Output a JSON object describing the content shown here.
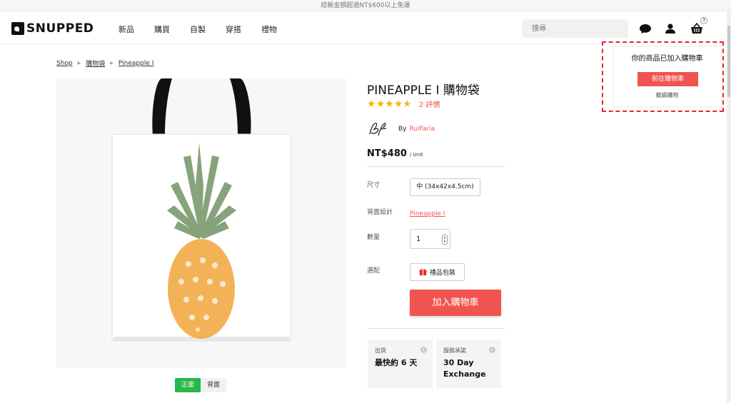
{
  "topbar": {
    "text": "結帳金額超過NT$600以上免運"
  },
  "header": {
    "logo": "SNUPPED",
    "nav": [
      "新品",
      "購買",
      "自製",
      "穿搭",
      "禮物"
    ],
    "search_placeholder": "搜尋",
    "cart_count": "3"
  },
  "breadcrumb": [
    "Shop",
    "購物袋",
    "Pineapple I"
  ],
  "product": {
    "title": "PINEAPPLE I 購物袋",
    "rating_stars": 4.5,
    "reviews": "2 評價",
    "by": "By",
    "artist": "RuiFaria",
    "price": "NT$480",
    "unit": "/ Unit"
  },
  "options": {
    "size_label": "尺寸",
    "size_value": "中 (34x42x4.5cm)",
    "back_label": "背面設計",
    "back_value": "Pineapple I",
    "qty_label": "數量",
    "qty_value": "1",
    "extra_label": "選配",
    "gift_label": "禮品包裝",
    "add_to_cart": "加入購物車"
  },
  "side_toggle": {
    "front": "正面",
    "back": "背面"
  },
  "info": [
    {
      "label": "出貨",
      "value": "最快約 6 天"
    },
    {
      "label": "服務承諾",
      "value": "30 Day Exchange"
    }
  ],
  "popup": {
    "title": "你的商品已加入購物車",
    "button": "前往購物車",
    "link": "繼續購物"
  },
  "colors": {
    "accent": "#f0544f",
    "active_toggle": "#27b849",
    "highlight": "#e8262c",
    "star": "#f4b400"
  }
}
